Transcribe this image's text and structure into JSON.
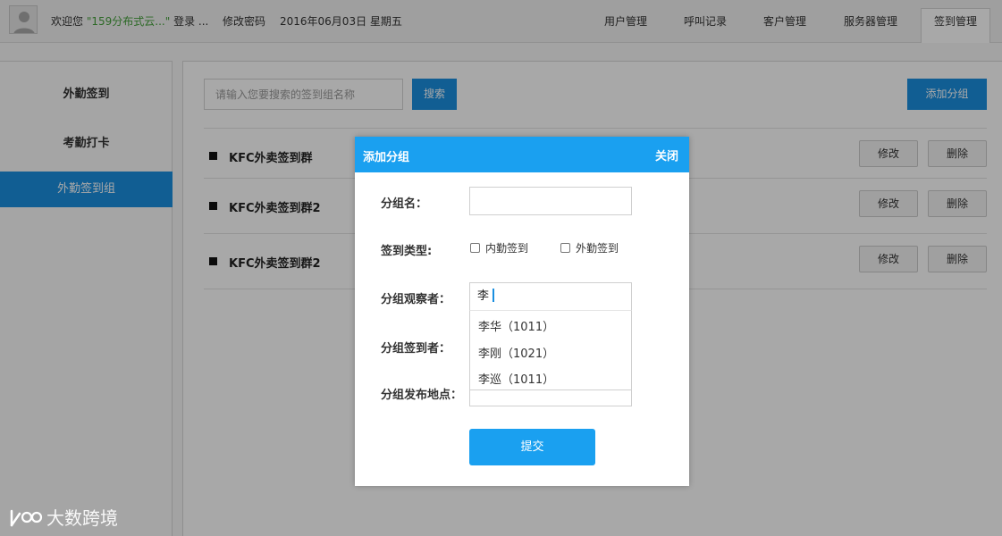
{
  "topbar": {
    "welcome_prefix": "欢迎您",
    "username": "\"159分布式云...\"",
    "welcome_suffix": "登录 ...",
    "change_password": "修改密码",
    "date": "2016年06月03日 星期五",
    "tabs": [
      {
        "label": "用户管理",
        "active": false
      },
      {
        "label": "呼叫记录",
        "active": false
      },
      {
        "label": "客户管理",
        "active": false
      },
      {
        "label": "服务器管理",
        "active": false
      },
      {
        "label": "签到管理",
        "active": true
      }
    ]
  },
  "sidebar": {
    "items": [
      {
        "label": "外勤签到",
        "active": false
      },
      {
        "label": "考勤打卡",
        "active": false
      },
      {
        "label": "外勤签到组",
        "active": true
      }
    ]
  },
  "main": {
    "search_placeholder": "请输入您要搜索的签到组名称",
    "search_button": "搜索",
    "add_group_button": "添加分组",
    "groups": [
      {
        "name": "KFC外卖签到群"
      },
      {
        "name": "KFC外卖签到群2"
      },
      {
        "name": "KFC外卖签到群2"
      }
    ],
    "edit_label": "修改",
    "delete_label": "删除"
  },
  "modal": {
    "title": "添加分组",
    "close": "关闭",
    "group_name_label": "分组名：",
    "group_name_value": "",
    "checkin_type_label": "签到类型:",
    "checkin_types": [
      "内勤签到",
      "外勤签到"
    ],
    "observer_label": "分组观察者：",
    "observer_value": "李",
    "suggestions": [
      "李华（1011）",
      "李刚（1021）",
      "李巡（1011）"
    ],
    "signer_label": "分组签到者：",
    "location_label": "分组发布地点：",
    "submit": "提交"
  },
  "watermark": {
    "text": "大数跨境"
  },
  "colors": {
    "accent": "#1a8fe0",
    "modal_header": "#1aa0f0",
    "username_green": "#44a03a"
  }
}
